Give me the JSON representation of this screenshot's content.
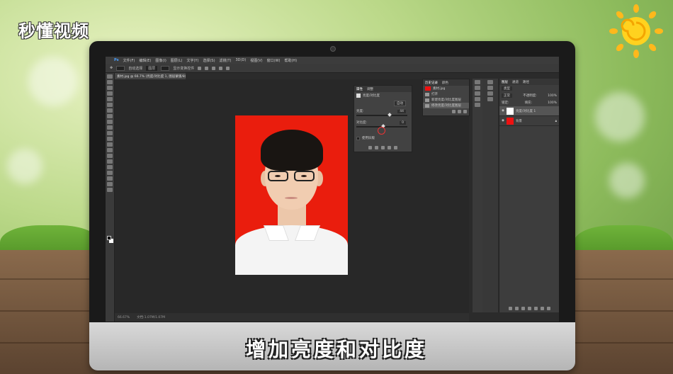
{
  "brand": {
    "logo_text": "秒懂视频"
  },
  "app": {
    "menubar": [
      "文件(F)",
      "编辑(E)",
      "图像(I)",
      "图层(L)",
      "文字(Y)",
      "选择(S)",
      "滤镜(T)",
      "3D(D)",
      "视图(V)",
      "窗口(W)",
      "帮助(H)"
    ],
    "options": {
      "auto_select_label": "自动选择",
      "layer_value": "图层",
      "transform_label": "显示变换控件"
    },
    "doc_tab": "素材.jpg @ 66.7% (亮度/对比度 1, 图层蒙版/8) *",
    "status": {
      "zoom": "66.67%",
      "doc_size": "文档:1.07M/1.07M"
    }
  },
  "properties": {
    "tabs": [
      "属性",
      "调整"
    ],
    "header": "亮度/对比度",
    "auto_button": "自动",
    "brightness_label": "亮度:",
    "brightness_value": "44",
    "contrast_label": "对比度:",
    "contrast_value": "0",
    "legacy_label": "使用旧版",
    "brightness_level": 0.62,
    "contrast_level": 0.5
  },
  "history": {
    "tabs": [
      "历史记录",
      "颜色"
    ],
    "snapshot": "素材.jpg",
    "items": [
      "打开",
      "新建亮度/对比度图层",
      "修改亮度/对比度图层"
    ],
    "selected_index": 2
  },
  "layers": {
    "tabs": [
      "图层",
      "通道",
      "路径"
    ],
    "kind_label": "类型",
    "blend_mode": "正常",
    "opacity_label": "不透明度:",
    "opacity_value": "100%",
    "lock_label": "锁定:",
    "fill_label": "填充:",
    "fill_value": "100%",
    "items": [
      {
        "name": "亮度/对比度 1",
        "selected": true
      },
      {
        "name": "背景",
        "selected": false
      }
    ]
  },
  "caption": "增加亮度和对比度",
  "colors": {
    "photo_bg": "#ea1d0d",
    "ps_dark": "#2b2b2b"
  }
}
